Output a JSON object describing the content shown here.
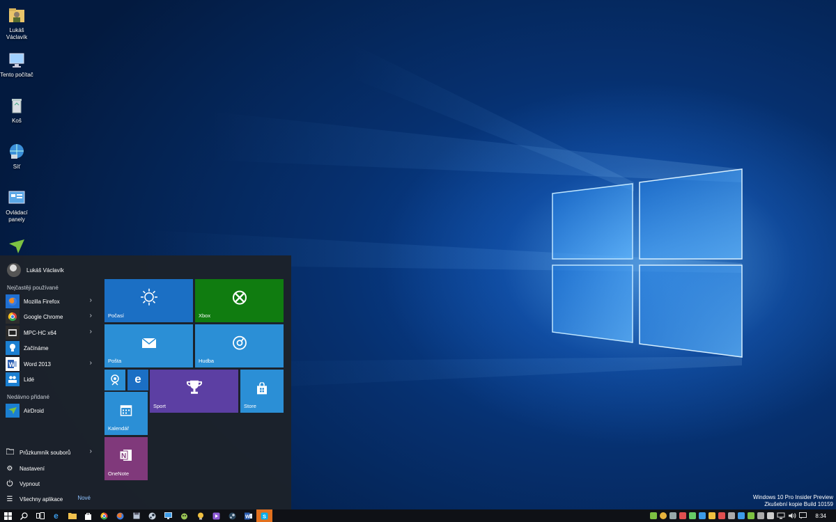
{
  "desktop": {
    "icons": [
      {
        "label_line1": "Lukáš",
        "label_line2": "Václavík",
        "icon": "user-folder-icon"
      },
      {
        "label_line1": "Tento počítač",
        "label_line2": "",
        "icon": "computer-icon"
      },
      {
        "label_line1": "Koš",
        "label_line2": "",
        "icon": "recycle-bin-icon"
      },
      {
        "label_line1": "Síť",
        "label_line2": "",
        "icon": "network-icon"
      },
      {
        "label_line1": "Ovládací",
        "label_line2": "panely",
        "icon": "control-panel-icon"
      },
      {
        "label_line1": "",
        "label_line2": "",
        "icon": "airdroid-icon"
      }
    ],
    "watermark": {
      "line1": "Windows 10 Pro Insider Preview",
      "line2": "Zkušební kopie Build 10159"
    }
  },
  "start_menu": {
    "user_name": "Lukáš Václavík",
    "most_used_header": "Nejčastěji používané",
    "most_used": [
      {
        "label": "Mozilla Firefox",
        "icon": "firefox-icon",
        "color": "#1f6fd1",
        "has_submenu": true
      },
      {
        "label": "Google Chrome",
        "icon": "chrome-icon",
        "color": "#2d2d2d",
        "has_submenu": true
      },
      {
        "label": "MPC-HC x64",
        "icon": "mpc-hc-icon",
        "color": "#2a2a2a",
        "has_submenu": true
      },
      {
        "label": "Začínáme",
        "icon": "lightbulb-icon",
        "color": "#1b7fd1",
        "has_submenu": false
      },
      {
        "label": "Word 2013",
        "icon": "word-icon",
        "color": "#ffffff",
        "has_submenu": true
      },
      {
        "label": "Lidé",
        "icon": "people-icon",
        "color": "#1b7fd1",
        "has_submenu": false
      }
    ],
    "recently_added_header": "Nedávno přidané",
    "recently_added": [
      {
        "label": "AirDroid",
        "icon": "airdroid-icon",
        "color": "#1b7fd1"
      }
    ],
    "bottom": [
      {
        "label": "Průzkumník souborů",
        "icon": "folder-icon",
        "has_submenu": true
      },
      {
        "label": "Nastavení",
        "icon": "gear-icon",
        "has_submenu": false
      },
      {
        "label": "Vypnout",
        "icon": "power-icon",
        "has_submenu": false
      },
      {
        "label": "Všechny aplikace",
        "icon": "list-icon",
        "has_submenu": false,
        "badge": "Nové"
      }
    ],
    "tiles": [
      {
        "label": "Počasí",
        "icon": "sun-icon",
        "color": "#1b6fc4"
      },
      {
        "label": "Xbox",
        "icon": "xbox-icon",
        "color": "#107c10"
      },
      {
        "label": "Pošta",
        "icon": "mail-icon",
        "color": "#2b8fd6"
      },
      {
        "label": "Hudba",
        "icon": "music-icon",
        "color": "#2b8fd6"
      },
      {
        "label": "",
        "icon": "camera-icon",
        "color": "#2b8fd6"
      },
      {
        "label": "",
        "icon": "edge-icon",
        "color": "#1b6fc4"
      },
      {
        "label": "Sport",
        "icon": "trophy-icon",
        "color": "#5c3fa3"
      },
      {
        "label": "Store",
        "icon": "store-icon",
        "color": "#2b8fd6"
      },
      {
        "label": "Kalendář",
        "icon": "calendar-icon",
        "color": "#2b8fd6"
      },
      {
        "label": "OneNote",
        "icon": "onenote-icon",
        "color": "#80397b"
      }
    ]
  },
  "taskbar": {
    "items": [
      {
        "icon": "start-icon",
        "color": "#ffffff"
      },
      {
        "icon": "search-icon",
        "color": "#ffffff"
      },
      {
        "icon": "task-view-icon",
        "color": "#ffffff"
      },
      {
        "icon": "edge-icon",
        "color": "#3c9be8"
      },
      {
        "icon": "file-explorer-icon",
        "color": "#f2c14e"
      },
      {
        "icon": "store-icon",
        "color": "#ffffff"
      },
      {
        "icon": "chrome-icon",
        "color": "#e8b33c"
      },
      {
        "icon": "firefox-icon",
        "color": "#e8762c"
      },
      {
        "icon": "save-icon",
        "color": "#b9c4d6"
      },
      {
        "icon": "steam-icon",
        "color": "#c9d3e0"
      },
      {
        "icon": "remote-desktop-icon",
        "color": "#3c9be8"
      },
      {
        "icon": "gimp-icon",
        "color": "#9ac454"
      },
      {
        "icon": "lightbulb-icon",
        "color": "#f0c040"
      },
      {
        "icon": "media-icon",
        "color": "#8e5bd6"
      },
      {
        "icon": "steam-icon",
        "color": "#c9d3e0"
      },
      {
        "icon": "word-icon",
        "color": "#2b5fb4"
      },
      {
        "icon": "skype-icon",
        "color": "#00aff0",
        "active": true
      }
    ],
    "tray_icons": [
      {
        "icon": "airdroid-tray-icon",
        "color": "#7dc242"
      },
      {
        "icon": "chrome-tray-icon",
        "color": "#e8b33c"
      },
      {
        "icon": "tray-app-icon",
        "color": "#9aa"
      },
      {
        "icon": "tray-app-icon",
        "color": "#e05050"
      },
      {
        "icon": "tray-app-icon",
        "color": "#6c6"
      },
      {
        "icon": "tray-app-icon",
        "color": "#3c9be8"
      },
      {
        "icon": "tray-app-icon",
        "color": "#f0c040"
      },
      {
        "icon": "tray-app-icon",
        "color": "#e05050"
      },
      {
        "icon": "tray-app-icon",
        "color": "#aaa"
      },
      {
        "icon": "tray-app-icon",
        "color": "#3c9be8"
      },
      {
        "icon": "tray-app-icon",
        "color": "#7dc242"
      },
      {
        "icon": "tray-app-icon",
        "color": "#aaa"
      },
      {
        "icon": "tray-app-icon",
        "color": "#ccc"
      },
      {
        "icon": "network-tray-icon",
        "color": "#ddd"
      },
      {
        "icon": "volume-icon",
        "color": "#ddd"
      },
      {
        "icon": "action-center-icon",
        "color": "#ddd"
      }
    ],
    "clock": "8:34"
  }
}
